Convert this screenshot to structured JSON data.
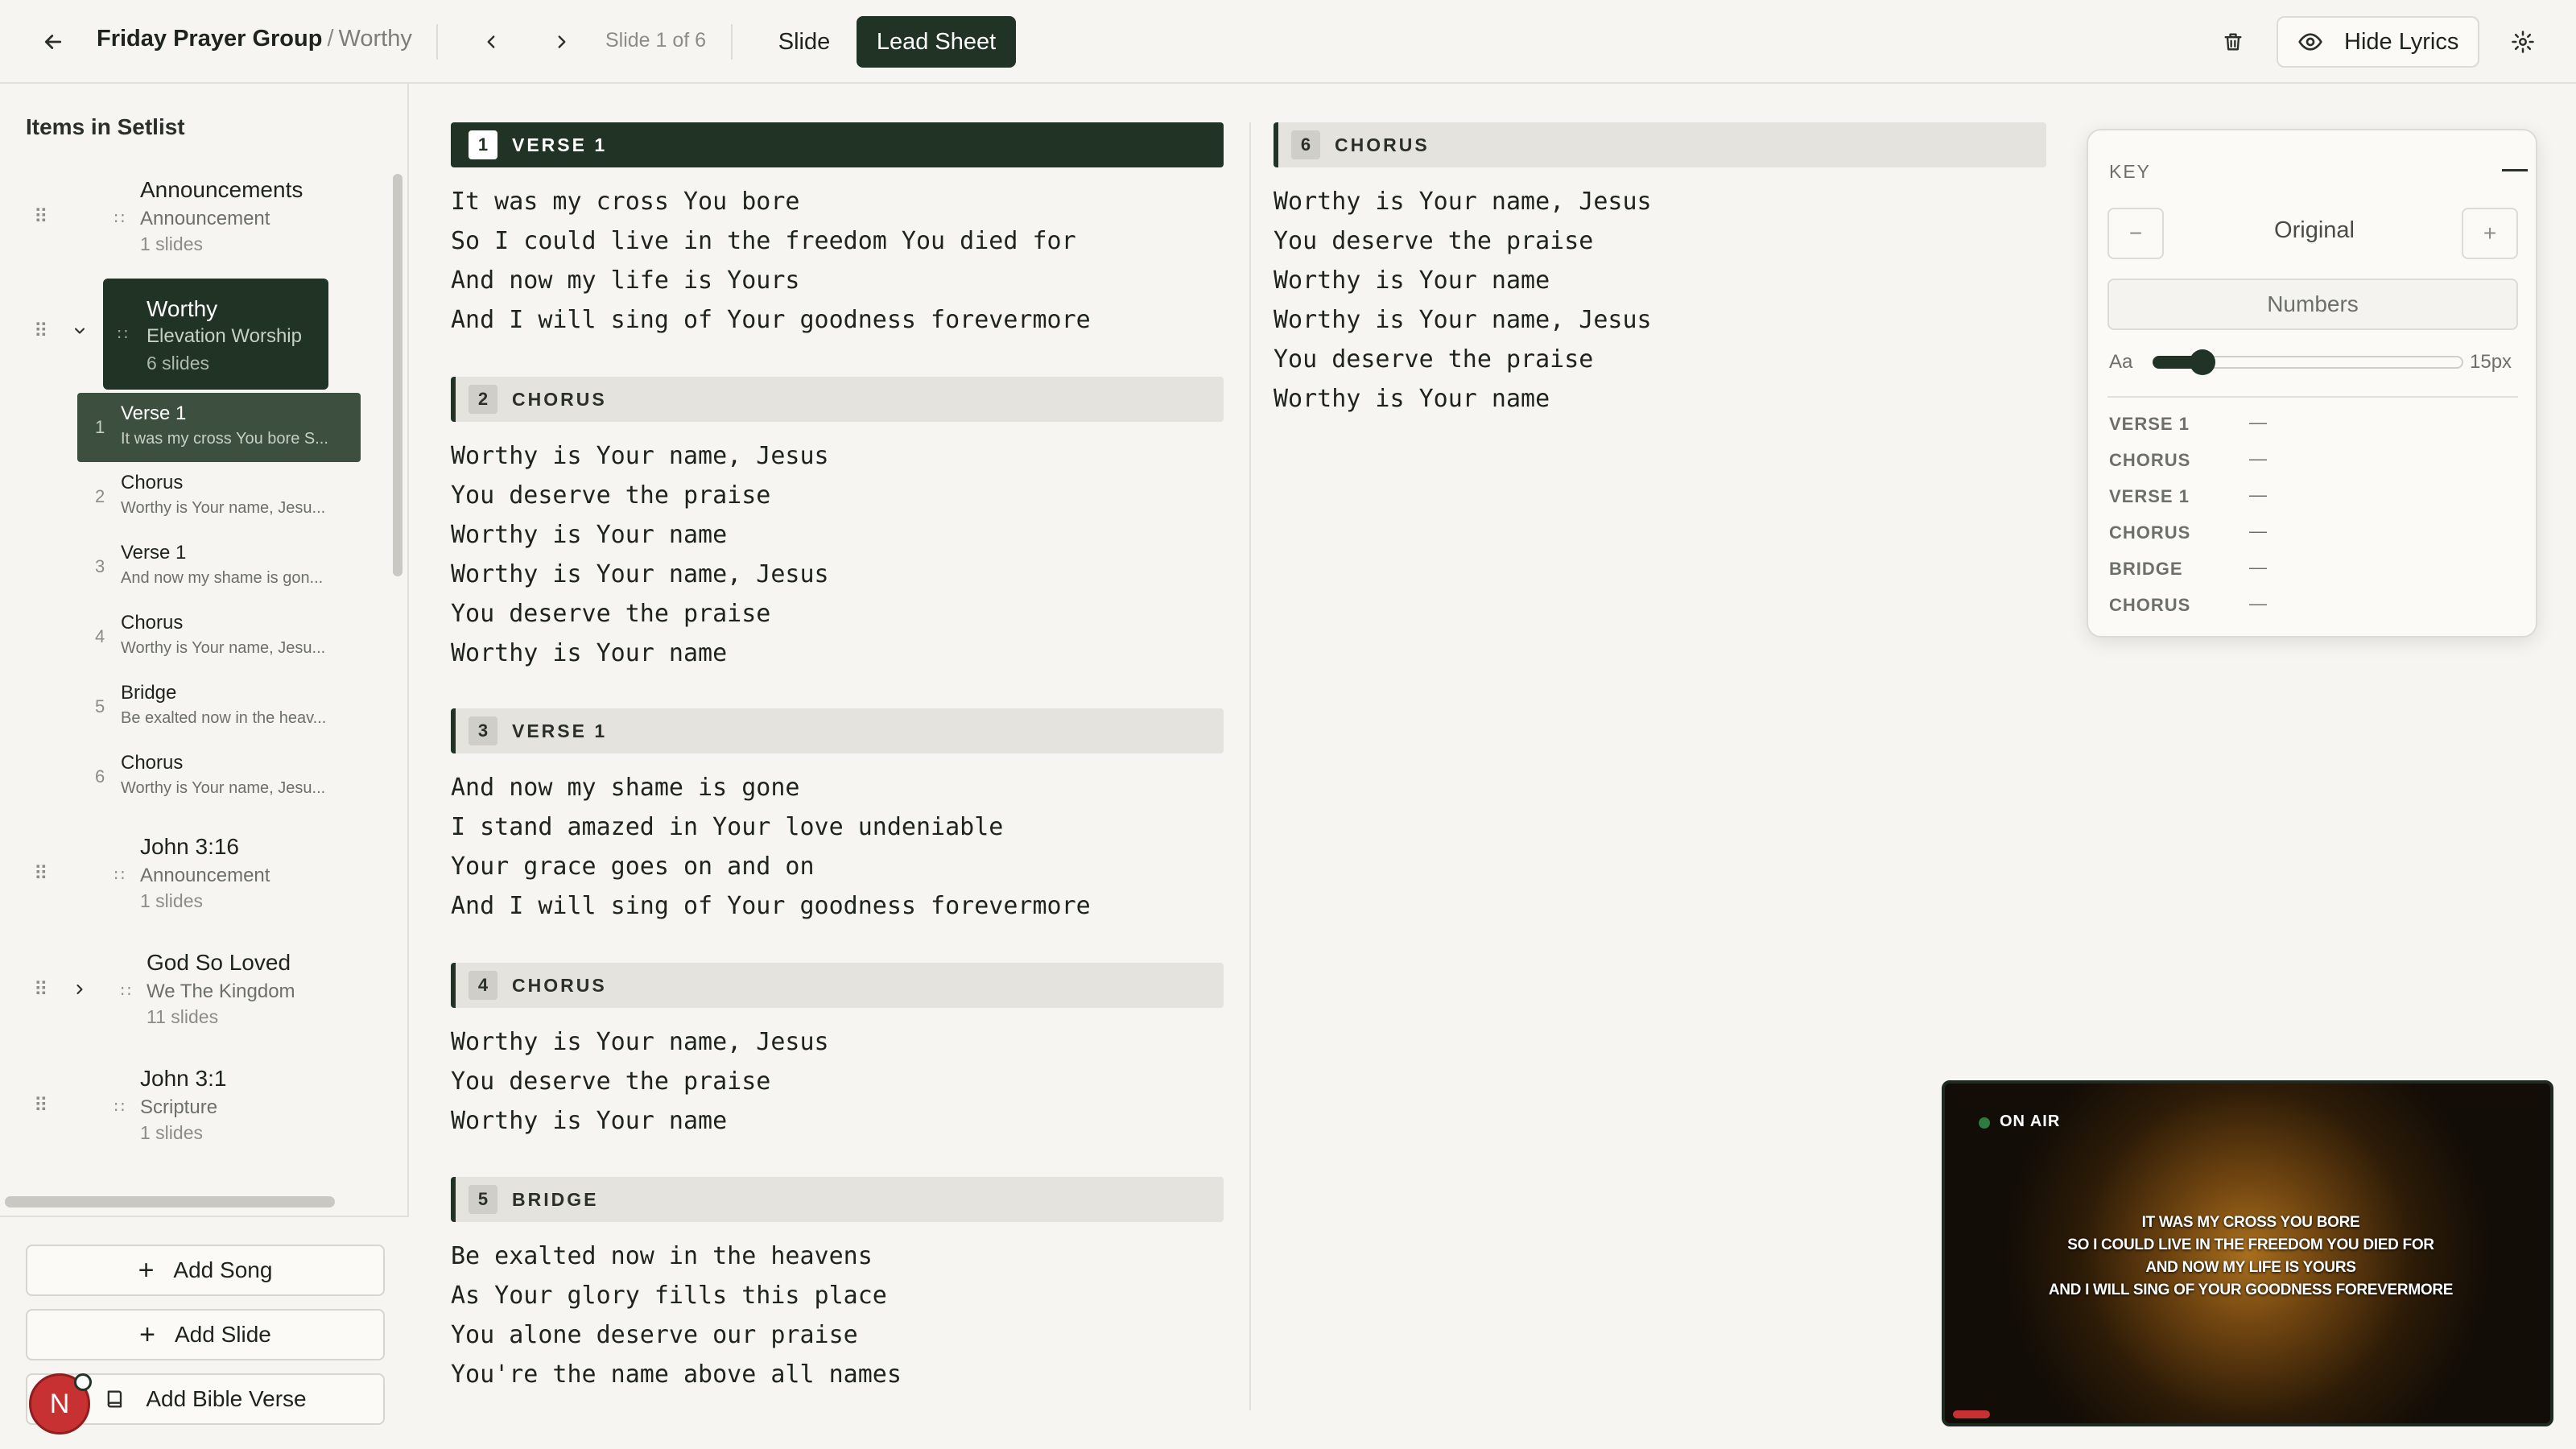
{
  "header": {
    "group": "Friday Prayer Group",
    "separator": "/",
    "song": "Worthy",
    "slide_count": "Slide 1 of 6",
    "tabs": [
      {
        "label": "Slide",
        "active": false
      },
      {
        "label": "Lead Sheet",
        "active": true
      }
    ],
    "hide_lyrics_label": "Hide Lyrics"
  },
  "sidebar": {
    "title": "Items in Setlist",
    "items": [
      {
        "title": "Announcements",
        "subtitle": "Announcement",
        "count": "1 slides"
      },
      {
        "title": "Worthy",
        "subtitle": "Elevation Worship",
        "count": "6 slides",
        "expanded": true
      },
      {
        "title": "John 3:16",
        "subtitle": "Announcement",
        "count": "1 slides"
      },
      {
        "title": "God So Loved",
        "subtitle": "We The Kingdom",
        "count": "11 slides"
      },
      {
        "title": "John 3:1",
        "subtitle": "Scripture",
        "count": "1 slides"
      }
    ],
    "worthy_slides": [
      {
        "num": "1",
        "name": "Verse 1",
        "preview": "It was my cross You bore S...",
        "active": true
      },
      {
        "num": "2",
        "name": "Chorus",
        "preview": "Worthy is Your name, Jesu..."
      },
      {
        "num": "3",
        "name": "Verse 1",
        "preview": "And now my shame is gon..."
      },
      {
        "num": "4",
        "name": "Chorus",
        "preview": "Worthy is Your name, Jesu..."
      },
      {
        "num": "5",
        "name": "Bridge",
        "preview": "Be exalted now in the heav..."
      },
      {
        "num": "6",
        "name": "Chorus",
        "preview": "Worthy is Your name, Jesu..."
      }
    ],
    "buttons": {
      "add_song": "Add Song",
      "add_slide": "Add Slide",
      "add_bible_verse": "Add Bible Verse"
    },
    "avatar_initial": "N"
  },
  "sections": [
    {
      "num": "1",
      "label": "VERSE 1",
      "active": true,
      "lines": [
        "It was my cross You bore",
        "So I could live in the freedom You died for",
        "And now my life is Yours",
        "And I will sing of Your goodness forevermore"
      ]
    },
    {
      "num": "2",
      "label": "CHORUS",
      "lines": [
        "Worthy is Your name, Jesus",
        "You deserve the praise",
        "Worthy is Your name",
        "Worthy is Your name, Jesus",
        "You deserve the praise",
        "Worthy is Your name"
      ]
    },
    {
      "num": "3",
      "label": "VERSE 1",
      "lines": [
        "And now my shame is gone",
        "I stand amazed in Your love undeniable",
        "Your grace goes on and on",
        "And I will sing of Your goodness forevermore"
      ]
    },
    {
      "num": "4",
      "label": "CHORUS",
      "lines": [
        "Worthy is Your name, Jesus",
        "You deserve the praise",
        "Worthy is Your name"
      ]
    },
    {
      "num": "5",
      "label": "BRIDGE",
      "lines": [
        "Be exalted now in the heavens",
        "As Your glory fills this place",
        "You alone deserve our praise",
        "You're the name above all names"
      ]
    },
    {
      "num": "6",
      "label": "CHORUS",
      "lines": [
        "Worthy is Your name, Jesus",
        "You deserve the praise",
        "Worthy is Your name",
        "Worthy is Your name, Jesus",
        "You deserve the praise",
        "Worthy is Your name"
      ]
    }
  ],
  "key_panel": {
    "label": "KEY",
    "minus": "−",
    "plus": "+",
    "original": "Original",
    "numbers": "Numbers",
    "font_label": "Aa",
    "font_size": "15px",
    "font_level": 0.12,
    "rows": [
      {
        "label": "VERSE 1",
        "value": "—"
      },
      {
        "label": "CHORUS",
        "value": "—"
      },
      {
        "label": "VERSE 1",
        "value": "—"
      },
      {
        "label": "CHORUS",
        "value": "—"
      },
      {
        "label": "BRIDGE",
        "value": "—"
      },
      {
        "label": "CHORUS",
        "value": "—"
      }
    ]
  },
  "preview": {
    "on_air": "ON AIR",
    "lines": [
      "IT WAS MY CROSS YOU BORE",
      "SO I COULD LIVE IN THE FREEDOM YOU DIED FOR",
      "AND NOW MY LIFE IS YOURS",
      "AND I WILL SING OF YOUR GOODNESS FOREVERMORE"
    ]
  },
  "icons": {
    "back": "arrow-left-icon",
    "prev": "chevron-left-icon",
    "next": "chevron-right-icon",
    "trash": "trash-icon",
    "eye": "eye-icon",
    "settings": "gear-icon",
    "grip": "drag-handle-icon",
    "plus": "plus-icon",
    "book": "book-icon"
  },
  "colors": {
    "accent": "#213325",
    "background": "#f6f5f1",
    "live": "#c73131"
  }
}
